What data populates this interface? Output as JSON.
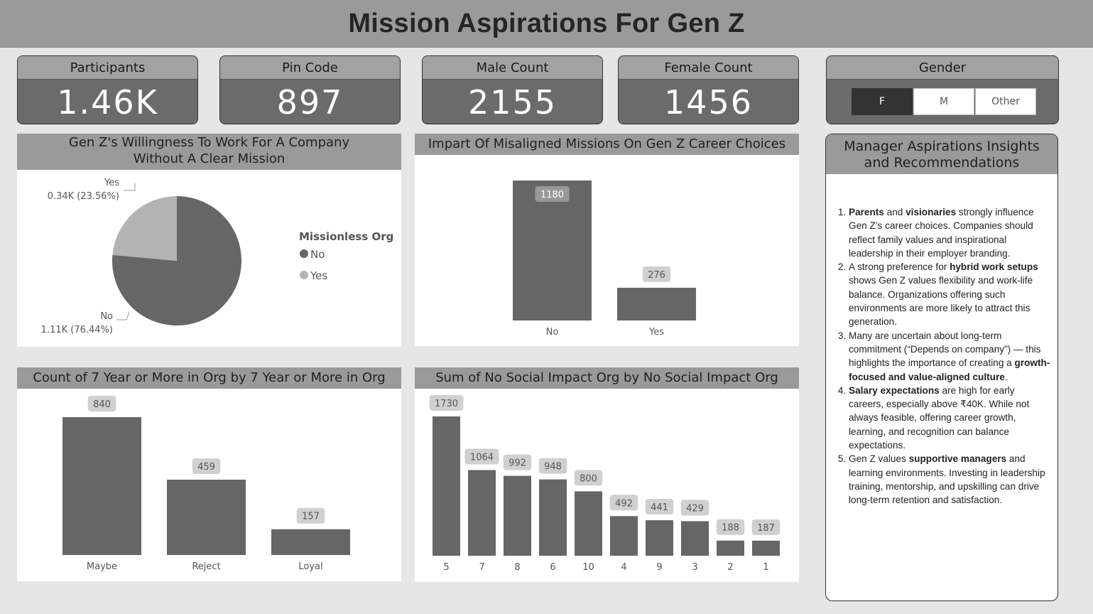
{
  "header": {
    "title": "Mission Aspirations For Gen Z"
  },
  "kpis": [
    {
      "label": "Participants",
      "value": "1.46K"
    },
    {
      "label": "Pin Code",
      "value": "897"
    },
    {
      "label": "Male Count",
      "value": "2155"
    },
    {
      "label": "Female Count",
      "value": "1456"
    }
  ],
  "gender_slicer": {
    "title": "Gender",
    "options": [
      "F",
      "M",
      "Other"
    ],
    "selected": "F"
  },
  "colors": {
    "dark": "#666666",
    "light": "#b3b3b3",
    "header": "#9a9a9a",
    "background": "#e6e6e6"
  },
  "pie_panel": {
    "title": "Gen Z's Willingness To Work For A Company Without A Clear Mission",
    "legend_title": "Missionless Org",
    "yes_label_name": "Yes",
    "yes_label_value": "0.34K (23.56%)",
    "no_label_name": "No",
    "no_label_value": "1.11K (76.44%)",
    "legend_no": "No",
    "legend_yes": "Yes"
  },
  "misaligned_panel": {
    "title": "Impart Of Misaligned Missions On Gen Z Career Choices"
  },
  "years_panel": {
    "title": "Count of 7 Year or More in Org by 7 Year or More in Org"
  },
  "social_panel": {
    "title": "Sum of No Social Impact Org by No Social Impact Org"
  },
  "chart_data": [
    {
      "type": "pie",
      "title": "Gen Z's Willingness To Work For A Company Without A Clear Mission",
      "legend_title": "Missionless Org",
      "categories": [
        "No",
        "Yes"
      ],
      "values": [
        1110,
        340
      ],
      "percentages": [
        76.44,
        23.56
      ],
      "colors": [
        "#666666",
        "#b3b3b3"
      ],
      "legend_position": "right"
    },
    {
      "type": "bar",
      "title": "Impart Of Misaligned Missions On Gen Z Career Choices",
      "categories": [
        "No",
        "Yes"
      ],
      "values": [
        1180,
        276
      ]
    },
    {
      "type": "bar",
      "title": "Count of 7 Year or More in Org by 7 Year or More in Org",
      "categories": [
        "Maybe",
        "Reject",
        "Loyal"
      ],
      "values": [
        840,
        459,
        157
      ]
    },
    {
      "type": "bar",
      "title": "Sum of No Social Impact Org by No Social Impact Org",
      "categories": [
        "5",
        "7",
        "8",
        "6",
        "10",
        "4",
        "9",
        "3",
        "2",
        "1"
      ],
      "values": [
        1730,
        1064,
        992,
        948,
        800,
        492,
        441,
        429,
        188,
        187
      ]
    }
  ],
  "insights": {
    "title": "Manager Aspirations Insights and Recommendations",
    "items": [
      [
        {
          "b": true,
          "t": "Parents"
        },
        {
          "b": false,
          "t": " and "
        },
        {
          "b": true,
          "t": "visionaries"
        },
        {
          "b": false,
          "t": " strongly influence Gen Z’s career choices. Companies should reflect family values and inspirational leadership in their employer branding."
        }
      ],
      [
        {
          "b": false,
          "t": "A strong preference for "
        },
        {
          "b": true,
          "t": "hybrid work setups"
        },
        {
          "b": false,
          "t": " shows Gen Z values flexibility and work-life balance. Organizations offering such environments are more likely to attract this generation."
        }
      ],
      [
        {
          "b": false,
          "t": "Many are uncertain about long-term commitment (“Depends on company”) — this highlights the importance of creating a "
        },
        {
          "b": true,
          "t": "growth-focused and value-aligned culture"
        },
        {
          "b": false,
          "t": "."
        }
      ],
      [
        {
          "b": true,
          "t": "Salary expectations"
        },
        {
          "b": false,
          "t": " are high for early careers, especially above ₹40K. While not always feasible, offering career growth, learning, and recognition can balance expectations."
        }
      ],
      [
        {
          "b": false,
          "t": "Gen Z values "
        },
        {
          "b": true,
          "t": "supportive managers"
        },
        {
          "b": false,
          "t": " and learning environments. Investing in leadership training, mentorship, and upskilling can drive long-term retention and satisfaction."
        }
      ]
    ]
  }
}
